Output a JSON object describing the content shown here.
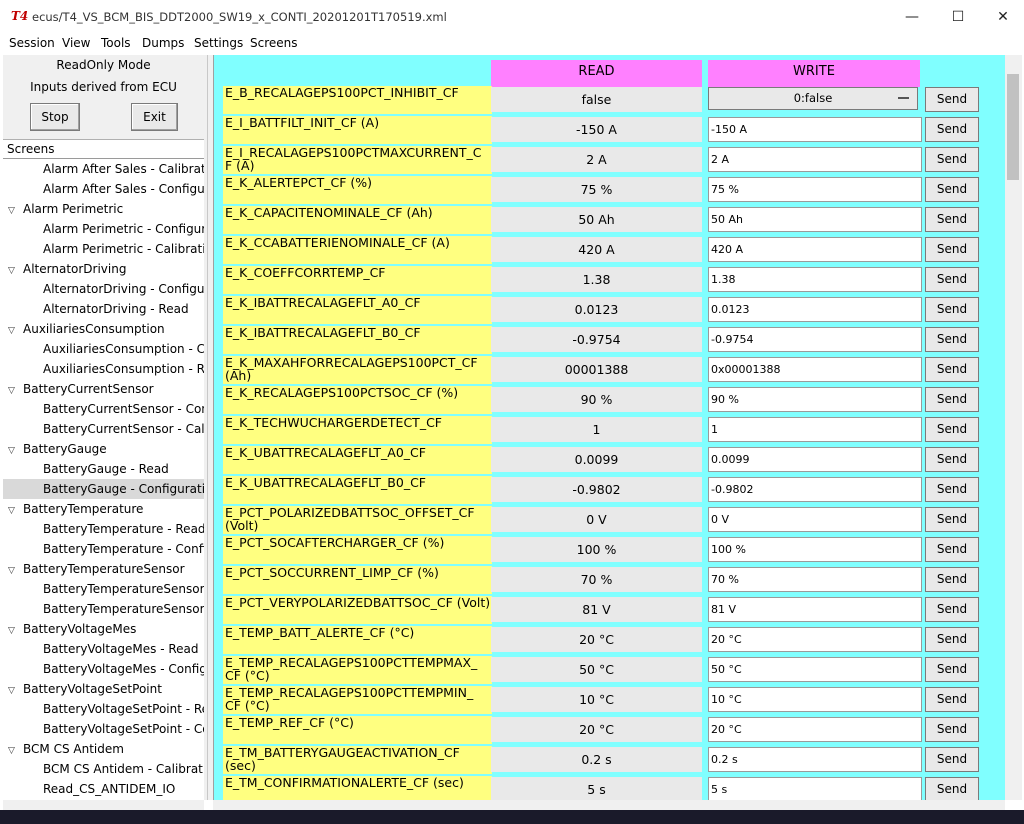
{
  "window": {
    "title": "ecus/T4_VS_BCM_BIS_DDT2000_SW19_x_CONTI_20201201T170519.xml",
    "app_icon_text": "T4",
    "min": "—",
    "max": "☐",
    "close": "✕"
  },
  "menu": [
    "Session",
    "View",
    "Tools",
    "Dumps",
    "Settings",
    "Screens"
  ],
  "left": {
    "mode": "ReadOnly Mode",
    "inputs": "Inputs derived from ECU",
    "stop": "Stop",
    "exit": "Exit",
    "tree_header": "Screens",
    "items": [
      {
        "label": "Alarm After Sales - Calibration",
        "level": 1
      },
      {
        "label": "Alarm After Sales - Configurat",
        "level": 1
      },
      {
        "label": "Alarm Perimetric",
        "level": 0
      },
      {
        "label": "Alarm Perimetric - Configurati",
        "level": 1
      },
      {
        "label": "Alarm Perimetric - Calibration",
        "level": 1
      },
      {
        "label": "AlternatorDriving",
        "level": 0
      },
      {
        "label": "AlternatorDriving - Configurat",
        "level": 1
      },
      {
        "label": "AlternatorDriving - Read",
        "level": 1
      },
      {
        "label": "AuxiliariesConsumption",
        "level": 0
      },
      {
        "label": "AuxiliariesConsumption - Conf",
        "level": 1
      },
      {
        "label": "AuxiliariesConsumption - Reac",
        "level": 1
      },
      {
        "label": "BatteryCurrentSensor",
        "level": 0
      },
      {
        "label": "BatteryCurrentSensor - Config",
        "level": 1
      },
      {
        "label": "BatteryCurrentSensor - Calibra",
        "level": 1
      },
      {
        "label": "BatteryGauge",
        "level": 0
      },
      {
        "label": "BatteryGauge - Read",
        "level": 1
      },
      {
        "label": "BatteryGauge - Configuration",
        "level": 1,
        "selected": true
      },
      {
        "label": "BatteryTemperature",
        "level": 0
      },
      {
        "label": "BatteryTemperature - Read",
        "level": 1
      },
      {
        "label": "BatteryTemperature - Configu",
        "level": 1
      },
      {
        "label": "BatteryTemperatureSensor",
        "level": 0
      },
      {
        "label": "BatteryTemperatureSensor - C",
        "level": 1
      },
      {
        "label": "BatteryTemperatureSensor - R",
        "level": 1
      },
      {
        "label": "BatteryVoltageMes",
        "level": 0
      },
      {
        "label": "BatteryVoltageMes - Read",
        "level": 1
      },
      {
        "label": "BatteryVoltageMes - Configura",
        "level": 1
      },
      {
        "label": "BatteryVoltageSetPoint",
        "level": 0
      },
      {
        "label": "BatteryVoltageSetPoint - Read",
        "level": 1
      },
      {
        "label": "BatteryVoltageSetPoint - Conf",
        "level": 1
      },
      {
        "label": "BCM CS Antidem",
        "level": 0
      },
      {
        "label": "BCM CS Antidem - Calibratior",
        "level": 1
      },
      {
        "label": "Read_CS_ANTIDEM_IO",
        "level": 1
      }
    ]
  },
  "table": {
    "read_header": "READ",
    "write_header": "WRITE",
    "send_label": "Send",
    "rows": [
      {
        "name": "E_B_RECALAGEPS100PCT_INHIBIT_CF",
        "read": "false",
        "write": "0:false",
        "type": "select"
      },
      {
        "name": "E_I_BATTFILT_INIT_CF (A)",
        "read": "-150 A",
        "write": "-150 A"
      },
      {
        "name": "E_I_RECALAGEPS100PCTMAXCURRENT_C F (A)",
        "read": "2 A",
        "write": "2 A"
      },
      {
        "name": "E_K_ALERTEPCT_CF (%)",
        "read": "75 %",
        "write": "75 %"
      },
      {
        "name": "E_K_CAPACITENOMINALE_CF (Ah)",
        "read": "50 Ah",
        "write": "50 Ah"
      },
      {
        "name": "E_K_CCABATTERIENOMINALE_CF (A)",
        "read": "420 A",
        "write": "420 A"
      },
      {
        "name": "E_K_COEFFCORRTEMP_CF",
        "read": "1.38",
        "write": "1.38"
      },
      {
        "name": "E_K_IBATTRECALAGEFLT_A0_CF",
        "read": "0.0123",
        "write": "0.0123"
      },
      {
        "name": "E_K_IBATTRECALAGEFLT_B0_CF",
        "read": "-0.9754",
        "write": "-0.9754"
      },
      {
        "name": "E_K_MAXAHFORRECALAGEPS100PCT_CF (Ah)",
        "read": "00001388",
        "write": "0x00001388"
      },
      {
        "name": "E_K_RECALAGEPS100PCTSOC_CF (%)",
        "read": "90 %",
        "write": "90 %"
      },
      {
        "name": "E_K_TECHWUCHARGERDETECT_CF",
        "read": "1",
        "write": "1"
      },
      {
        "name": "E_K_UBATTRECALAGEFLT_A0_CF",
        "read": "0.0099",
        "write": "0.0099"
      },
      {
        "name": "E_K_UBATTRECALAGEFLT_B0_CF",
        "read": "-0.9802",
        "write": "-0.9802"
      },
      {
        "name": "E_PCT_POLARIZEDBATTSOC_OFFSET_CF (Volt)",
        "read": "0 V",
        "write": "0 V"
      },
      {
        "name": "E_PCT_SOCAFTERCHARGER_CF (%)",
        "read": "100 %",
        "write": "100 %"
      },
      {
        "name": "E_PCT_SOCCURRENT_LIMP_CF (%)",
        "read": "70 %",
        "write": "70 %"
      },
      {
        "name": "E_PCT_VERYPOLARIZEDBATTSOC_CF (Volt)",
        "read": "81 V",
        "write": "81 V"
      },
      {
        "name": "E_TEMP_BATT_ALERTE_CF (°C)",
        "read": "20 °C",
        "write": "20 °C"
      },
      {
        "name": "E_TEMP_RECALAGEPS100PCTTEMPMAX_ CF (°C)",
        "read": "50 °C",
        "write": "50 °C"
      },
      {
        "name": "E_TEMP_RECALAGEPS100PCTTEMPMIN_ CF (°C)",
        "read": "10 °C",
        "write": "10 °C"
      },
      {
        "name": "E_TEMP_REF_CF (°C)",
        "read": "20 °C",
        "write": "20 °C"
      },
      {
        "name": "E_TM_BATTERYGAUGEACTIVATION_CF (sec)",
        "read": "0.2 s",
        "write": "0.2 s"
      },
      {
        "name": "E_TM_CONFIRMATIONALERTE_CF (sec)",
        "read": "5 s",
        "write": "5 s"
      }
    ]
  }
}
